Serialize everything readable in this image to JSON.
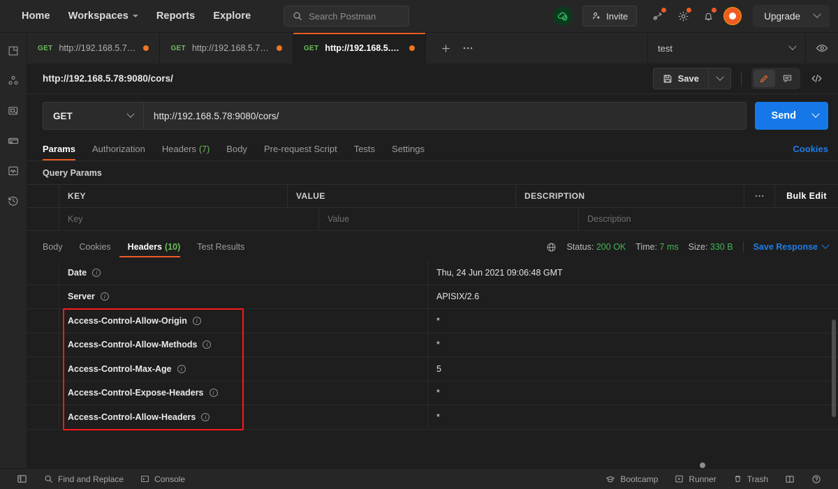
{
  "topbar": {
    "nav": [
      {
        "label": "Home",
        "has_caret": false
      },
      {
        "label": "Workspaces",
        "has_caret": true
      },
      {
        "label": "Reports",
        "has_caret": false
      },
      {
        "label": "Explore",
        "has_caret": false
      }
    ],
    "search": {
      "placeholder": "Search Postman",
      "icon": "search-icon"
    },
    "cloud_status_icon": "cloud-check-icon",
    "invite_label": "Invite",
    "icons": [
      "satellite-icon",
      "gear-icon",
      "bell-icon"
    ],
    "avatar": "user-avatar",
    "upgrade_label": "Upgrade"
  },
  "rail": {
    "items": [
      {
        "icon": "collections-icon",
        "label": "Collections"
      },
      {
        "icon": "apis-icon",
        "label": "APIs"
      },
      {
        "icon": "environments-icon",
        "label": "Environments"
      },
      {
        "icon": "mock-servers-icon",
        "label": "Mock Servers"
      },
      {
        "icon": "monitors-icon",
        "label": "Monitors"
      },
      {
        "icon": "history-icon",
        "label": "History"
      }
    ]
  },
  "tabstrip": {
    "tabs": [
      {
        "method": "GET",
        "title": "http://192.168.5.78...",
        "unsaved": true,
        "active": false
      },
      {
        "method": "GET",
        "title": "http://192.168.5.78...",
        "unsaved": true,
        "active": false
      },
      {
        "method": "GET",
        "title": "http://192.168.5.78...",
        "unsaved": true,
        "active": true
      }
    ],
    "new_tab_icon": "plus-icon",
    "more_icon": "ellipsis-icon",
    "environment": "test",
    "env_chevron_icon": "chevron-down-icon",
    "eye_icon": "eye-icon"
  },
  "request_header": {
    "title": "http://192.168.5.78:9080/cors/",
    "save_label": "Save",
    "save_icon": "floppy-disk-icon",
    "save_chevron_icon": "chevron-down-icon",
    "segments": [
      {
        "icon": "pencil-icon",
        "active": true
      },
      {
        "icon": "comment-icon",
        "active": false
      }
    ],
    "code_icon": "code-icon"
  },
  "url_row": {
    "method": "GET",
    "method_chevron_icon": "chevron-down-icon",
    "url": "http://192.168.5.78:9080/cors/",
    "send_label": "Send",
    "send_chevron_icon": "chevron-down-icon",
    "send_color": "#1678e8"
  },
  "request_tabs": {
    "tabs": [
      {
        "label": "Params",
        "count": null,
        "active": true
      },
      {
        "label": "Authorization",
        "count": null,
        "active": false
      },
      {
        "label": "Headers",
        "count": "(7)",
        "active": false
      },
      {
        "label": "Body",
        "count": null,
        "active": false
      },
      {
        "label": "Pre-request Script",
        "count": null,
        "active": false
      },
      {
        "label": "Tests",
        "count": null,
        "active": false
      },
      {
        "label": "Settings",
        "count": null,
        "active": false
      }
    ],
    "cookies_link": "Cookies"
  },
  "query_params": {
    "section_title": "Query Params",
    "columns": [
      "KEY",
      "VALUE",
      "DESCRIPTION"
    ],
    "more_icon": "ellipsis-icon",
    "bulk_edit_label": "Bulk Edit",
    "placeholder_row": {
      "key": "Key",
      "value": "Value",
      "description": "Description"
    }
  },
  "response": {
    "tabs": [
      {
        "label": "Body",
        "count": null,
        "active": false
      },
      {
        "label": "Cookies",
        "count": null,
        "active": false
      },
      {
        "label": "Headers",
        "count": "(10)",
        "active": true
      },
      {
        "label": "Test Results",
        "count": null,
        "active": false
      }
    ],
    "globe_icon": "globe-icon",
    "status_label": "Status:",
    "status_value": "200 OK",
    "time_label": "Time:",
    "time_value": "7 ms",
    "size_label": "Size:",
    "size_value": "330 B",
    "save_response_label": "Save Response",
    "save_response_chevron_icon": "chevron-down-icon",
    "status_color": "#44b556",
    "headers": [
      {
        "key": "Date",
        "value": "Thu, 24 Jun 2021 09:06:48 GMT",
        "highlighted": false
      },
      {
        "key": "Server",
        "value": "APISIX/2.6",
        "highlighted": false
      },
      {
        "key": "Access-Control-Allow-Origin",
        "value": "*",
        "highlighted": true
      },
      {
        "key": "Access-Control-Allow-Methods",
        "value": "*",
        "highlighted": true
      },
      {
        "key": "Access-Control-Max-Age",
        "value": "5",
        "highlighted": true
      },
      {
        "key": "Access-Control-Expose-Headers",
        "value": "*",
        "highlighted": true
      },
      {
        "key": "Access-Control-Allow-Headers",
        "value": "*",
        "highlighted": true
      }
    ],
    "highlight_color": "#fc1a1a"
  },
  "statusbar": {
    "sidebar_toggle_icon": "panel-toggle-icon",
    "left_items": [
      {
        "label": "Find and Replace",
        "icon": "search-icon"
      },
      {
        "label": "Console",
        "icon": "console-icon"
      }
    ],
    "right_items": [
      {
        "label": "Bootcamp",
        "icon": "bootcamp-icon"
      },
      {
        "label": "Runner",
        "icon": "runner-icon"
      },
      {
        "label": "Trash",
        "icon": "trash-icon"
      }
    ],
    "layout_icon": "layout-icon",
    "help_icon": "help-icon"
  }
}
